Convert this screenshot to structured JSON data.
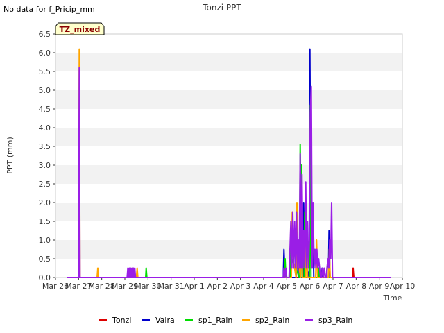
{
  "note": "No data for f_Pricip_mm",
  "badge": "TZ_mixed",
  "chart_data": {
    "type": "line",
    "title": "Tonzi PPT",
    "xlabel": "Time",
    "ylabel": "PPT (mm)",
    "x_ticks": [
      "Mar 26",
      "Mar 27",
      "Mar 28",
      "Mar 29",
      "Mar 30",
      "Mar 31",
      "Apr 1",
      "Apr 2",
      "Apr 3",
      "Apr 4",
      "Apr 5",
      "Apr 6",
      "Apr 7",
      "Apr 8",
      "Apr 9",
      "Apr 10"
    ],
    "y_ticks": [
      "0.0",
      "0.5",
      "1.0",
      "1.5",
      "2.0",
      "2.5",
      "3.0",
      "3.5",
      "4.0",
      "4.5",
      "5.0",
      "5.5",
      "6.0",
      "6.5"
    ],
    "ylim": [
      0,
      6.5
    ],
    "xlim_days": [
      0,
      15
    ],
    "grid": "horizontal bands",
    "legend_position": "bottom",
    "series": [
      {
        "name": "Tonzi",
        "color": "#dd0000",
        "x": [
          0.5,
          12.85,
          12.87,
          12.9,
          14.5
        ],
        "y": [
          0,
          0,
          0.25,
          0,
          0
        ]
      },
      {
        "name": "Vaira",
        "color": "#0000cc",
        "x": [
          0.5,
          9.85,
          9.88,
          9.92,
          10.4,
          10.45,
          10.5,
          10.7,
          10.73,
          10.76,
          10.97,
          11.0,
          11.04,
          11.1,
          11.13,
          11.17,
          11.5,
          11.53,
          11.56,
          11.8,
          11.83,
          11.87,
          14.5
        ],
        "y": [
          0,
          0,
          0.75,
          0,
          0,
          0.75,
          0,
          0,
          2.0,
          0.5,
          0,
          6.1,
          1.5,
          0.5,
          1.5,
          0,
          0,
          0.25,
          0,
          0,
          1.25,
          0,
          0
        ]
      },
      {
        "name": "sp1_Rain",
        "color": "#00dd00",
        "x": [
          0.5,
          3.9,
          3.92,
          3.95,
          9.9,
          9.93,
          9.96,
          10.15,
          10.18,
          10.21,
          10.55,
          10.58,
          10.61,
          10.64,
          10.67,
          10.75,
          10.78,
          10.81,
          10.98,
          11.02,
          11.05,
          11.35,
          11.38,
          11.41,
          14.5
        ],
        "y": [
          0,
          0,
          0.25,
          0,
          0,
          0.5,
          0,
          0,
          1.0,
          0.5,
          0,
          3.55,
          1.5,
          3.0,
          0,
          0,
          1.75,
          0,
          0,
          4.6,
          0,
          0,
          0.25,
          0,
          0
        ]
      },
      {
        "name": "sp2_Rain",
        "color": "#ffa500",
        "x": [
          0.5,
          1.0,
          1.03,
          1.06,
          1.8,
          1.83,
          1.86,
          3.5,
          3.53,
          3.56,
          10.2,
          10.24,
          10.28,
          10.4,
          10.44,
          10.48,
          10.6,
          10.64,
          10.68,
          10.82,
          10.86,
          10.9,
          11.25,
          11.29,
          11.33,
          11.8,
          11.84,
          11.88,
          14.5
        ],
        "y": [
          0,
          0,
          6.1,
          0,
          0,
          0.25,
          0,
          0,
          0.25,
          0,
          0,
          1.75,
          0.5,
          0,
          2.0,
          0.5,
          0,
          1.75,
          0,
          0,
          1.5,
          0,
          0,
          1.0,
          0,
          0,
          0.75,
          0,
          0
        ]
      },
      {
        "name": "sp3_Rain",
        "color": "#9a1ee6",
        "x": [
          0.5,
          1.0,
          1.03,
          1.06,
          3.1,
          3.13,
          3.16,
          3.19,
          3.22,
          3.25,
          3.28,
          3.31,
          3.34,
          3.37,
          3.4,
          3.43,
          3.46,
          9.85,
          9.88,
          9.92,
          9.96,
          10.0,
          10.1,
          10.14,
          10.18,
          10.22,
          10.26,
          10.3,
          10.34,
          10.38,
          10.42,
          10.46,
          10.5,
          10.54,
          10.58,
          10.62,
          10.66,
          10.7,
          10.74,
          10.78,
          10.82,
          10.86,
          10.9,
          10.94,
          10.98,
          11.02,
          11.06,
          11.1,
          11.14,
          11.18,
          11.22,
          11.26,
          11.3,
          11.34,
          11.38,
          11.42,
          11.46,
          11.5,
          11.54,
          11.58,
          11.62,
          11.66,
          11.7,
          11.74,
          11.78,
          11.82,
          11.86,
          11.9,
          11.94,
          11.98,
          14.5
        ],
        "y": [
          0,
          0,
          5.6,
          0,
          0,
          0.25,
          0,
          0.25,
          0,
          0.25,
          0,
          0.25,
          0,
          0.25,
          0,
          0.25,
          0,
          0,
          0.25,
          0,
          0.25,
          0,
          0,
          0.75,
          1.5,
          0.25,
          1.75,
          0.25,
          1.5,
          0.25,
          1.75,
          0.25,
          1.0,
          0.25,
          3.3,
          0.25,
          2.75,
          0.25,
          1.25,
          0.25,
          2.55,
          0.25,
          1.5,
          0.25,
          1.0,
          4.4,
          5.1,
          0.25,
          2.0,
          0.25,
          0.75,
          0.25,
          0.75,
          0.25,
          0.5,
          0.25,
          0,
          0,
          0.25,
          0,
          0.25,
          0,
          0,
          0.25,
          0.5,
          0.25,
          1.0,
          0.5,
          2.0,
          0,
          0
        ]
      }
    ]
  }
}
